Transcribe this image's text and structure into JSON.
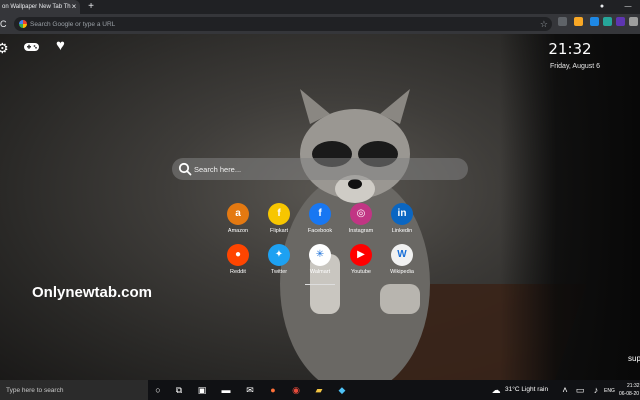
{
  "browser": {
    "tab_title": "on Wallpaper New Tab Th",
    "tab_close": "×",
    "new_tab": "+",
    "omnibox_placeholder": "Search Google or type a URL",
    "star": "☆",
    "reload": "C",
    "window_dot": "●",
    "window_minimize": "—"
  },
  "extension_colors": [
    "#5f6368",
    "#f9a825",
    "#1e88e5",
    "#26a69a",
    "#5e35b1",
    "#9e9e9e",
    "#43a047",
    "#7e57c2"
  ],
  "newtab": {
    "top_icons": [
      "gear-icon",
      "gamepad-icon",
      "heart-icon"
    ],
    "time": "21:32",
    "date": "Friday, August 6",
    "search_placeholder": "Search here...",
    "brand": "Onlynewtab.com",
    "corner_text": "sup",
    "shortcuts": [
      {
        "label": "Amazon",
        "glyph": "a",
        "color": "#e47911"
      },
      {
        "label": "Flipkart",
        "glyph": "f",
        "color": "#f7c600"
      },
      {
        "label": "Facebook",
        "glyph": "f",
        "color": "#1877f2"
      },
      {
        "label": "Instagram",
        "glyph": "◎",
        "color": "#c13584"
      },
      {
        "label": "Linkedin",
        "glyph": "in",
        "color": "#0a66c2"
      },
      {
        "label": "Reddit",
        "glyph": "●",
        "color": "#ff4500"
      },
      {
        "label": "Twitter",
        "glyph": "✦",
        "color": "#1da1f2"
      },
      {
        "label": "Walmart",
        "glyph": "✳",
        "color": "#ffffff"
      },
      {
        "label": "Youtube",
        "glyph": "▶",
        "color": "#ff0000"
      },
      {
        "label": "Wikipedia",
        "glyph": "W",
        "color": "#f1f1f1"
      }
    ]
  },
  "taskbar": {
    "search_placeholder": "Type here to search",
    "weather": "31°C  Light rain",
    "lang": "ENG",
    "time": "21:32",
    "date": "06-08-20"
  }
}
